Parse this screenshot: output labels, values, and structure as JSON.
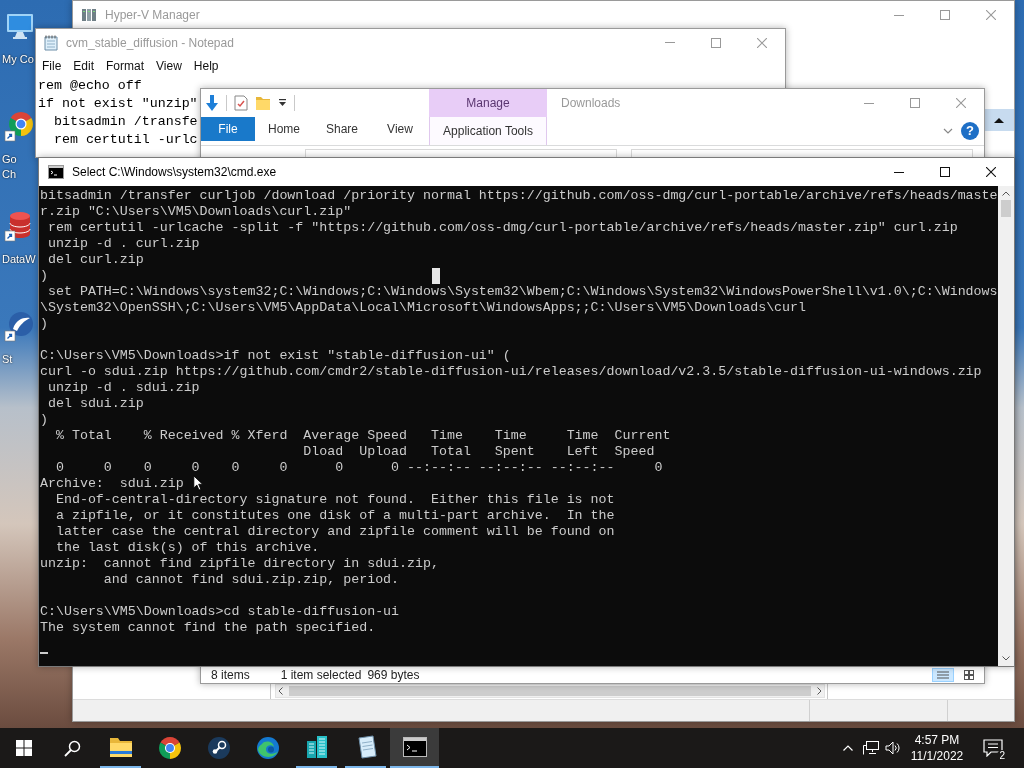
{
  "desktop": {
    "icons": [
      {
        "kind": "computer",
        "label_lines": [
          "My Co"
        ]
      },
      {
        "kind": "chrome",
        "label_lines": [
          "Go",
          "Ch"
        ]
      },
      {
        "kind": "database",
        "label_lines": [
          "DataW"
        ]
      },
      {
        "kind": "app",
        "label_lines": [
          "St"
        ]
      }
    ]
  },
  "hyperv_window": {
    "title": "Hyper-V Manager",
    "active": false
  },
  "notepad_window": {
    "title": "cvm_stable_diffusion - Notepad",
    "active": false,
    "menu": [
      "File",
      "Edit",
      "Format",
      "View",
      "Help"
    ],
    "lines": [
      "rem @echo off",
      "if not exist \"unzip\"",
      "  bitsadmin /transfe",
      "  rem certutil -urlc"
    ]
  },
  "explorer_window": {
    "title": "Downloads",
    "active": false,
    "context_group": "Manage",
    "tabs": [
      {
        "label": "File",
        "kind": "file",
        "selected": false
      },
      {
        "label": "Home",
        "kind": "tab",
        "selected": false
      },
      {
        "label": "Share",
        "kind": "tab",
        "selected": false
      },
      {
        "label": "View",
        "kind": "tab",
        "selected": false
      },
      {
        "label": "Application Tools",
        "kind": "context",
        "selected": false
      }
    ],
    "help": "?",
    "status": [
      "8 items",
      "1 item selected",
      "969 bytes"
    ],
    "view_modes": [
      {
        "kind": "details",
        "selected": true
      },
      {
        "kind": "large_icons",
        "selected": false
      }
    ]
  },
  "cmd_window": {
    "title": "Select C:\\Windows\\system32\\cmd.exe",
    "active": true,
    "blocks": [
      [
        "bitsadmin /transfer curljob /download /priority normal https://github.com/oss-dmg/curl-portable/archive/refs/heads/maste",
        "r.zip \"C:\\Users\\VM5\\Downloads\\curl.zip\"",
        " rem certutil -urlcache -split -f \"https://github.com/oss-dmg/curl-portable/archive/refs/heads/master.zip\" curl.zip",
        " unzip -d . curl.zip",
        " del curl.zip",
        ")",
        " set PATH=C:\\Windows\\system32;C:\\Windows;C:\\Windows\\System32\\Wbem;C:\\Windows\\System32\\WindowsPowerShell\\v1.0\\;C:\\Windows",
        "\\System32\\OpenSSH\\;C:\\Users\\VM5\\AppData\\Local\\Microsoft\\WindowsApps;;C:\\Users\\VM5\\Downloads\\curl",
        ")"
      ],
      [
        "C:\\Users\\VM5\\Downloads>if not exist \"stable-diffusion-ui\" (",
        "curl -o sdui.zip https://github.com/cmdr2/stable-diffusion-ui/releases/download/v2.3.5/stable-diffusion-ui-windows.zip",
        " unzip -d . sdui.zip",
        " del sdui.zip",
        ")",
        "  % Total    % Received % Xferd  Average Speed   Time    Time     Time  Current",
        "                                 Dload  Upload   Total   Spent    Left  Speed",
        "  0     0    0     0    0     0      0      0 --:--:-- --:--:-- --:--:--     0",
        "Archive:  sdui.zip",
        "  End-of-central-directory signature not found.  Either this file is not",
        "  a zipfile, or it constitutes one disk of a multi-part archive.  In the",
        "  latter case the central directory and zipfile comment will be found on",
        "  the last disk(s) of this archive.",
        "unzip:  cannot find zipfile directory in sdui.zip,",
        "        and cannot find sdui.zip.zip, period."
      ],
      [
        "C:\\Users\\VM5\\Downloads>cd stable-diffusion-ui",
        "The system cannot find the path specified."
      ]
    ]
  },
  "taskbar": {
    "items": [
      {
        "kind": "start",
        "running": false,
        "active": false
      },
      {
        "kind": "search",
        "running": false,
        "active": false
      },
      {
        "kind": "explorer",
        "running": true,
        "active": false
      },
      {
        "kind": "chrome",
        "running": false,
        "active": false
      },
      {
        "kind": "steam",
        "running": false,
        "active": false
      },
      {
        "kind": "edge",
        "running": false,
        "active": false
      },
      {
        "kind": "buildings",
        "running": true,
        "active": false
      },
      {
        "kind": "notepad",
        "running": true,
        "active": false
      },
      {
        "kind": "cmd",
        "running": true,
        "active": true
      }
    ],
    "tray": {
      "time": "4:57 PM",
      "date": "11/1/2022",
      "notifications": "2"
    }
  }
}
